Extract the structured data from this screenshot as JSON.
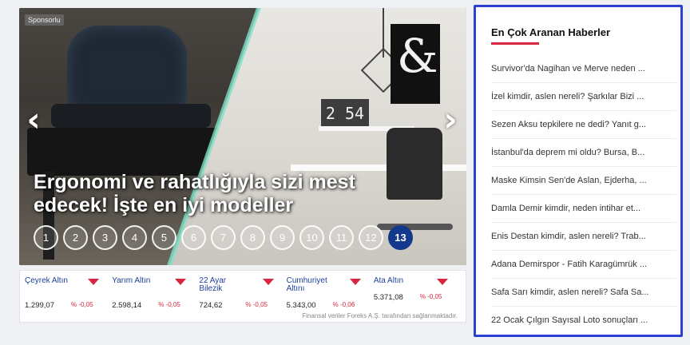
{
  "slider": {
    "sponsor_label": "Sponsorlu",
    "prev_arrow": "‹",
    "next_arrow": "›",
    "headline": "Ergonomi ve rahatlığıyla sizi mest edecek! İşte en iyi modeller",
    "clock_text": "2 54",
    "frame_symbol": "&",
    "pages": [
      "1",
      "2",
      "3",
      "4",
      "5",
      "6",
      "7",
      "8",
      "9",
      "10",
      "11",
      "12",
      "13"
    ],
    "active_page": "13"
  },
  "ticker": {
    "items": [
      {
        "name": "Çeyrek Altın",
        "value": "1.299,07",
        "change": "% -0,05"
      },
      {
        "name": "Yarım Altın",
        "value": "2.598,14",
        "change": "% -0,05"
      },
      {
        "name": "22 Ayar Bilezik",
        "value": "724,62",
        "change": "% -0,05"
      },
      {
        "name": "Cumhuriyet Altını",
        "value": "5.343,00",
        "change": "% -0,06"
      },
      {
        "name": "Ata Altın",
        "value": "5.371,08",
        "change": "% -0,05"
      }
    ],
    "footer": "Finansal veriler Foreks A.Ş. tarafından sağlanmaktadır.",
    "down_color": "#d7263d"
  },
  "panel": {
    "title": "En Çok Aranan Haberler",
    "items": [
      "Survivor'da Nagihan ve Merve neden ...",
      "İzel kimdir, aslen nereli? Şarkılar Bizi ...",
      "Sezen Aksu tepkilere ne dedi? Yanıt g...",
      "İstanbul'da deprem mi oldu? Bursa, B...",
      "Maske Kimsin Sen'de Aslan, Ejderha, ...",
      "Damla Demir kimdir, neden intihar et...",
      "Enis Destan kimdir, aslen nereli? Trab...",
      "Adana Demirspor - Fatih Karagümrük ...",
      "Safa Sarı kimdir, aslen nereli? Safa Sa...",
      "22 Ocak Çılgın Sayısal Loto sonuçları ..."
    ],
    "border_color": "#2b3fd1",
    "accent_color": "#d7263d"
  }
}
